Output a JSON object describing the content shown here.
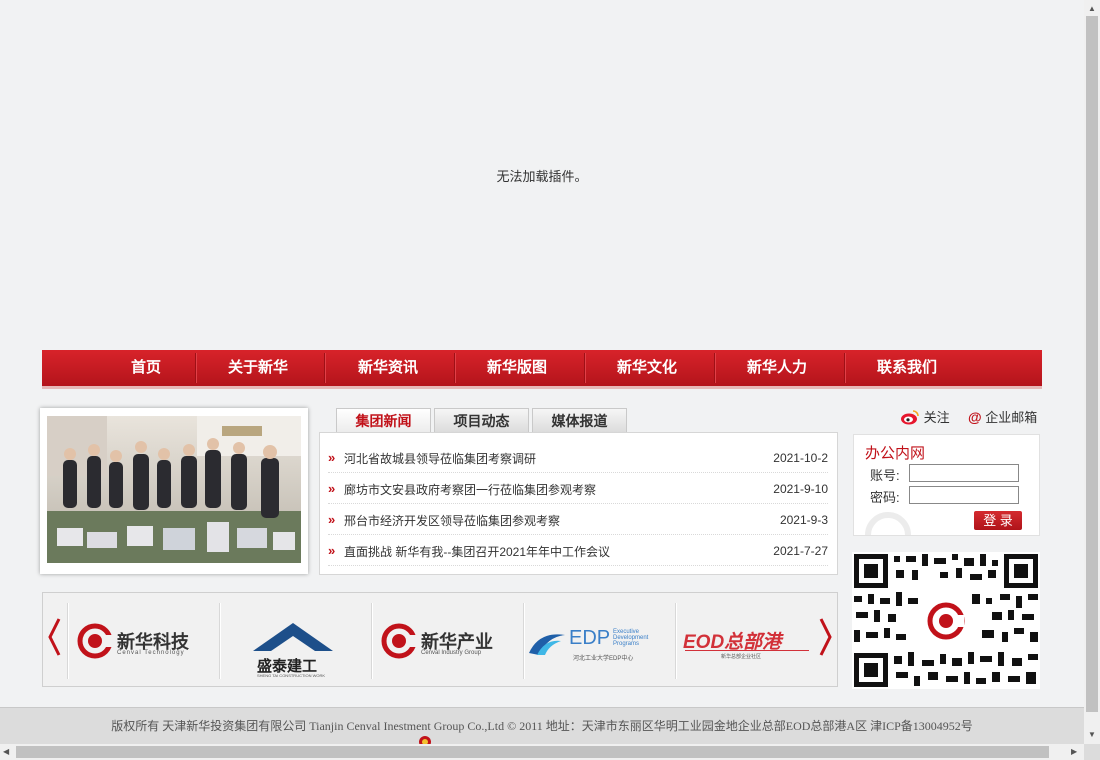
{
  "plugin_message": "无法加载插件。",
  "nav": {
    "items": [
      "首页",
      "关于新华",
      "新华资讯",
      "新华版图",
      "新华文化",
      "新华人力",
      "联系我们"
    ]
  },
  "news_tabs": [
    "集团新闻",
    "项目动态",
    "媒体报道"
  ],
  "news": [
    {
      "title": "河北省故城县领导莅临集团考察调研",
      "date": "2021-10-2"
    },
    {
      "title": "廊坊市文安县政府考察团一行莅临集团参观考察",
      "date": "2021-9-10"
    },
    {
      "title": "邢台市经济开发区领导莅临集团参观考察",
      "date": "2021-9-3"
    },
    {
      "title": "直面挑战 新华有我--集团召开2021年年中工作会议",
      "date": "2021-7-27"
    }
  ],
  "social": {
    "follow": "关注",
    "mail": "企业邮箱"
  },
  "login": {
    "title": "办公内网",
    "account_label": "账号:",
    "password_label": "密码:",
    "submit": "登 录"
  },
  "partners": [
    {
      "name": "新华科技",
      "sub": "Cenval Technology"
    },
    {
      "name": "盛泰建工",
      "sub": "SHENG TAI CONSTRUCTION WORK"
    },
    {
      "name": "新华产业",
      "sub": "Cenval Industry Group"
    },
    {
      "name": "EDP",
      "sub": "Executive Development Programs",
      "cn": "河北工业大学EDP中心"
    },
    {
      "name": "EOD总部港",
      "sub": "新华总部企业社区"
    }
  ],
  "footer": "版权所有 天津新华投资集团有限公司 Tianjin Cenval Inestment Group Co.,Ltd © 2011 地址：天津市东丽区华明工业园金地企业总部EOD总部港A区   津ICP备13004952号",
  "colors": {
    "brand_red": "#c1121a",
    "nav_red": "#c81b22"
  }
}
